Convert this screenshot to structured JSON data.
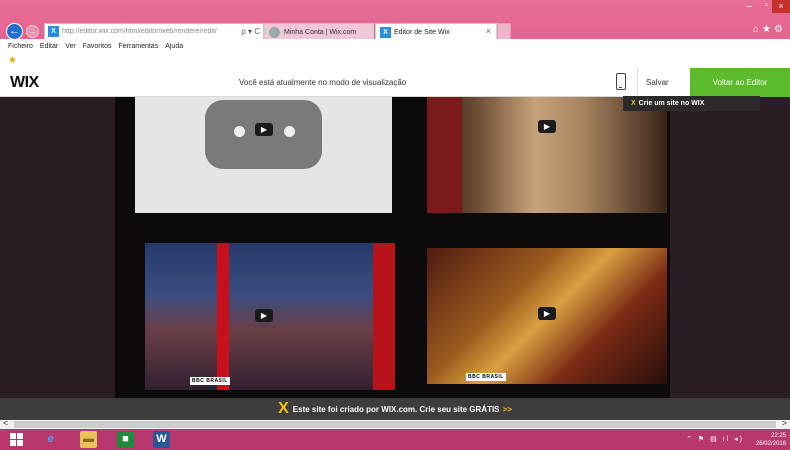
{
  "browser": {
    "address": "http://editor.wix.com/html/editor/web/renderer/edit/",
    "address_icons": "ρ ▾ C",
    "tabs": [
      {
        "label": "Minha Conta | Wix.com"
      },
      {
        "label": "Editor de Site Wix"
      }
    ],
    "menu": [
      "Ficheiro",
      "Editar",
      "Ver",
      "Favoritos",
      "Ferramentas",
      "Ajuda"
    ]
  },
  "wix_bar": {
    "logo": "WIX",
    "preview_message": "Você está atualmente no modo de visualização",
    "save_label": "Salvar",
    "back_label": "Voltar ao Editor",
    "tooltip": "Crie um site no WIX"
  },
  "videos": [
    {
      "badge": ""
    },
    {
      "badge": ""
    },
    {
      "badge": "BBC BRASIL"
    },
    {
      "badge": "BBC BRASIL"
    }
  ],
  "footer_banner": {
    "text": "Este site foi criado por WIX.com. Crie seu site GRÁTIS",
    "chevron": ">>"
  },
  "taskbar": {
    "time": "22:25",
    "date": "26/02/2016"
  },
  "colors": {
    "titlebar": "#e46390",
    "wix_green": "#5cbb2a",
    "taskbar": "#b8386e",
    "wix_yellow": "#f1c40f"
  }
}
